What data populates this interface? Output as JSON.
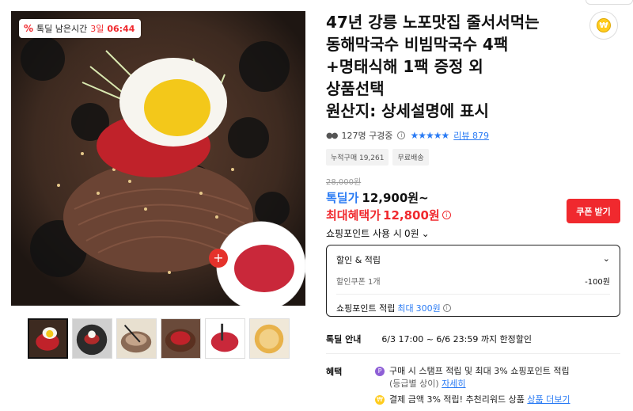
{
  "gallery": {
    "badge": {
      "icon": "percent-icon",
      "label": "톡딜 남은시간",
      "days": "3일",
      "time": "06:44"
    },
    "thumbnails": [
      "thumb-1",
      "thumb-2",
      "thumb-3",
      "thumb-4",
      "thumb-5",
      "thumb-6"
    ],
    "active_thumbnail": 0
  },
  "product": {
    "title": "47년 강릉 노포맛집 줄서서먹는\n동해막국수 비빔막국수 4팩\n+명태식해 1팩 증정 외\n상품선택\n원산지: 상세설명에 표시",
    "viewers": "127명 구경중",
    "rating_stars": "★★★★★",
    "review_link": "리뷰 879",
    "tags": [
      "누적구매 19,261",
      "무료배송"
    ],
    "original_price": "28,000원",
    "deal_price_label": "톡딜가",
    "deal_price": "12,900원~",
    "max_benefit_label": "최대혜택가",
    "max_benefit_price": "12,800원",
    "coupon_button": "쿠폰 받기",
    "points_use": "쇼핑포인트 사용 시",
    "points_use_value": "0원"
  },
  "benefit_box": {
    "title": "할인 & 적립",
    "coupon_label": "할인쿠폰 1개",
    "coupon_amount": "-100원",
    "points_label": "쇼핑포인트 적립",
    "points_max_label": "최대",
    "points_max_value": "300원"
  },
  "deal_guide": {
    "key": "톡딜 안내",
    "value": "6/3 17:00 ~ 6/6 23:59 까지 한정할인"
  },
  "benefits": {
    "key": "혜택",
    "item1_text": "구매 시 스탬프 적립 및 최대 3% 쇼핑포인트 적립",
    "item1_sub": "(등급별 상이)",
    "item1_link": "자세히",
    "item2_text": "결제 금액 3% 적립! 추천리워드 상품",
    "item2_link": "상품 더보기"
  },
  "colors": {
    "accent_red": "#f0292e",
    "accent_blue": "#2a7bf4"
  }
}
